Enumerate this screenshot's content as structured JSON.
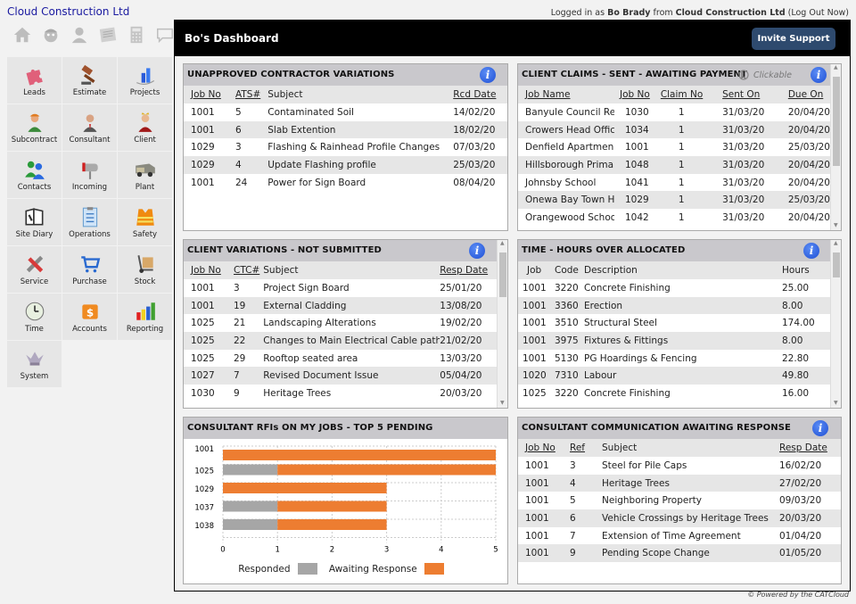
{
  "header": {
    "company": "Cloud Construction Ltd",
    "logged_prefix": "Logged in as",
    "user": "Bo Brady",
    "from": "from",
    "org": "Cloud Construction Ltd",
    "logout": "(Log Out Now)",
    "toolbar_icons": [
      "home-icon",
      "worker-icon",
      "person-icon",
      "document-icon",
      "calculator-icon",
      "chat-icon"
    ]
  },
  "nav": {
    "items": [
      {
        "label": "Leads",
        "icon": "puzzle-icon"
      },
      {
        "label": "Estimate",
        "icon": "gavel-icon"
      },
      {
        "label": "Projects",
        "icon": "bar-building-icon"
      },
      {
        "label": "Subcontract",
        "icon": "worker-icon"
      },
      {
        "label": "Consultant",
        "icon": "businessman-icon"
      },
      {
        "label": "Client",
        "icon": "king-icon"
      },
      {
        "label": "Contacts",
        "icon": "people-icon"
      },
      {
        "label": "Incoming",
        "icon": "mailbox-icon"
      },
      {
        "label": "Plant",
        "icon": "truck-icon"
      },
      {
        "label": "Site Diary",
        "icon": "diary-icon"
      },
      {
        "label": "Operations",
        "icon": "checklist-icon"
      },
      {
        "label": "Safety",
        "icon": "safety-vest-icon"
      },
      {
        "label": "Service",
        "icon": "tools-icon"
      },
      {
        "label": "Purchase",
        "icon": "cart-icon"
      },
      {
        "label": "Stock",
        "icon": "hand-truck-icon"
      },
      {
        "label": "Time",
        "icon": "clock-icon"
      },
      {
        "label": "Accounts",
        "icon": "money-box-icon"
      },
      {
        "label": "Reporting",
        "icon": "bar-chart-icon"
      },
      {
        "label": "System",
        "icon": "crown-icon"
      }
    ]
  },
  "main": {
    "title": "Bo's Dashboard",
    "invite_label": "Invite Support"
  },
  "panels": {
    "contractor_variations": {
      "title": "UNAPPROVED CONTRACTOR VARIATIONS",
      "columns": [
        "Job No",
        "ATS#",
        "Subject",
        "Rcd Date"
      ],
      "rows": [
        [
          "1001",
          "5",
          "Contaminated Soil",
          "14/02/20"
        ],
        [
          "1001",
          "6",
          "Slab Extention",
          "18/02/20"
        ],
        [
          "1029",
          "3",
          "Flashing & Rainhead Profile Changes",
          "07/03/20"
        ],
        [
          "1029",
          "4",
          "Update Flashing profile",
          "25/03/20"
        ],
        [
          "1001",
          "24",
          "Power for Sign Board",
          "08/04/20"
        ]
      ]
    },
    "client_claims": {
      "title": "CLIENT CLAIMS - SENT - AWAITING PAYMENT",
      "clickable_label": "Clickable",
      "columns": [
        "Job Name",
        "Job No",
        "Claim No",
        "Sent On",
        "Due On"
      ],
      "rows": [
        [
          "Banyule Council Re",
          "1030",
          "1",
          "31/03/20",
          "20/04/20"
        ],
        [
          "Crowers Head Offic",
          "1034",
          "1",
          "31/03/20",
          "20/04/20"
        ],
        [
          "Denfield Apartmen",
          "1001",
          "1",
          "31/03/20",
          "25/03/20"
        ],
        [
          "Hillsborough Prima",
          "1048",
          "1",
          "31/03/20",
          "20/04/20"
        ],
        [
          "Johnsby School",
          "1041",
          "1",
          "31/03/20",
          "20/04/20"
        ],
        [
          "Onewa Bay Town H",
          "1029",
          "1",
          "31/03/20",
          "25/03/20"
        ],
        [
          "Orangewood Schoo",
          "1042",
          "1",
          "31/03/20",
          "20/04/20"
        ]
      ]
    },
    "client_variations": {
      "title": "CLIENT VARIATIONS - NOT SUBMITTED",
      "columns": [
        "Job No",
        "CTC#",
        "Subject",
        "Resp Date"
      ],
      "rows": [
        [
          "1001",
          "3",
          "Project Sign Board",
          "25/01/20"
        ],
        [
          "1001",
          "19",
          "External Cladding",
          "13/08/20"
        ],
        [
          "1025",
          "21",
          "Landscaping Alterations",
          "19/02/20"
        ],
        [
          "1025",
          "22",
          "Changes to Main Electrical Cable pathv",
          "21/02/20"
        ],
        [
          "1025",
          "29",
          "Rooftop seated area",
          "13/03/20"
        ],
        [
          "1027",
          "7",
          "Revised Document Issue",
          "05/04/20"
        ],
        [
          "1030",
          "9",
          "Heritage Trees",
          "20/03/20"
        ]
      ]
    },
    "hours_over": {
      "title": "TIME - HOURS OVER ALLOCATED",
      "columns": [
        "Job",
        "Code",
        "Description",
        "Hours"
      ],
      "rows": [
        [
          "1001",
          "3220",
          "Concrete Finishing",
          "25.00"
        ],
        [
          "1001",
          "3360",
          "Erection",
          "8.00"
        ],
        [
          "1001",
          "3510",
          "Structural Steel",
          "174.00"
        ],
        [
          "1001",
          "3975",
          "Fixtures & Fittings",
          "8.00"
        ],
        [
          "1001",
          "5130",
          "PG Hoardings & Fencing",
          "22.80"
        ],
        [
          "1020",
          "7310",
          "Labour",
          "49.80"
        ],
        [
          "1025",
          "3220",
          "Concrete Finishing",
          "16.00"
        ]
      ]
    },
    "rfis": {
      "title": "CONSULTANT RFIs ON MY JOBS - TOP 5 PENDING"
    },
    "consultant_comm": {
      "title": "CONSULTANT COMMUNICATION AWAITING RESPONSE",
      "columns": [
        "Job No",
        "Ref",
        "Subject",
        "Resp Date"
      ],
      "rows": [
        [
          "1001",
          "3",
          "Steel for Pile Caps",
          "16/02/20"
        ],
        [
          "1001",
          "4",
          "Heritage Trees",
          "27/02/20"
        ],
        [
          "1001",
          "5",
          "Neighboring Property",
          "09/03/20"
        ],
        [
          "1001",
          "6",
          "Vehicle Crossings by Heritage Trees",
          "20/03/20"
        ],
        [
          "1001",
          "7",
          "Extension of Time Agreement",
          "01/04/20"
        ],
        [
          "1001",
          "9",
          "Pending Scope Change",
          "01/05/20"
        ]
      ]
    }
  },
  "chart_data": {
    "type": "bar",
    "orientation": "horizontal",
    "stacked": true,
    "title": "CONSULTANT RFIs ON MY JOBS - TOP 5 PENDING",
    "categories": [
      "1001",
      "1025",
      "1029",
      "1037",
      "1038"
    ],
    "series": [
      {
        "name": "Responded",
        "color": "#a6a6a6",
        "values": [
          0,
          1,
          0,
          1,
          1
        ]
      },
      {
        "name": "Awaiting Response",
        "color": "#ed7d31",
        "values": [
          5,
          4,
          3,
          2,
          2
        ]
      }
    ],
    "xlim": [
      0,
      5
    ],
    "xticks": [
      "0",
      "1",
      "2",
      "3",
      "4",
      "5"
    ],
    "grid": true,
    "legend": "bottom",
    "xlabel": "",
    "ylabel": ""
  },
  "footer": "© Powered by the CATCloud"
}
